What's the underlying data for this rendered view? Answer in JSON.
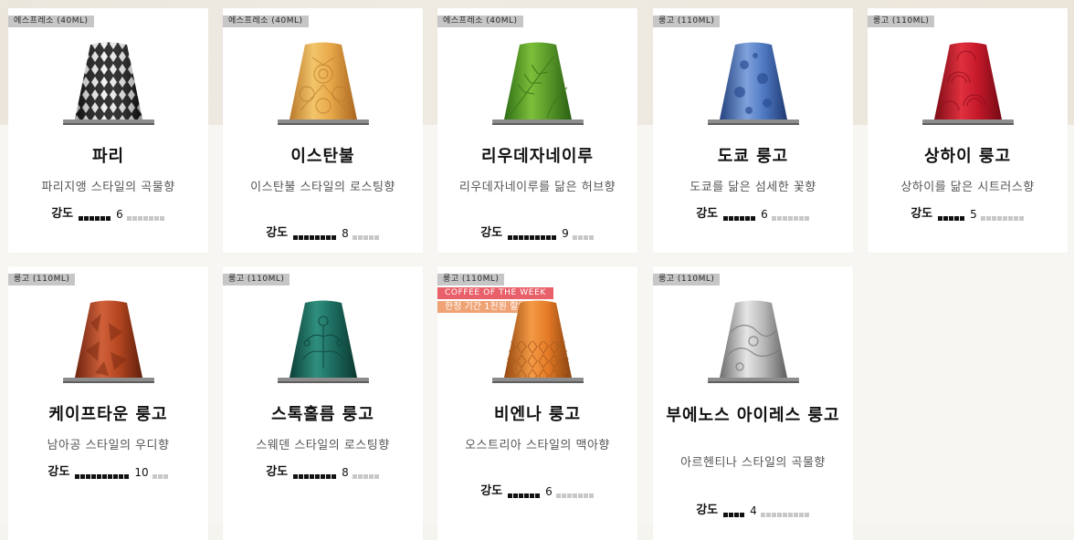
{
  "cards": [
    {
      "tag": "에스프레소 (40ML)",
      "name": "파리",
      "desc": "파리지앵 스타일의 곡물향",
      "intensity_label": "강도",
      "intensity": 6
    },
    {
      "tag": "에스프레소 (40ML)",
      "name": "이스탄불",
      "desc": "이스탄불 스타일의 로스팅향",
      "intensity_label": "강도",
      "intensity": 8
    },
    {
      "tag": "에스프레소 (40ML)",
      "name": "리우데자네이루",
      "desc": "리우데자네이루를 닮은 허브향",
      "intensity_label": "강도",
      "intensity": 9
    },
    {
      "tag": "룽고 (110ML)",
      "name": "도쿄 룽고",
      "desc": "도쿄를 닮은 섬세한 꽃향",
      "intensity_label": "강도",
      "intensity": 6
    },
    {
      "tag": "룽고 (110ML)",
      "name": "상하이 룽고",
      "desc": "상하이를 닮은 시트러스향",
      "intensity_label": "강도",
      "intensity": 5
    },
    {
      "tag": "룽고 (110ML)",
      "name": "케이프타운 룽고",
      "desc": "남아공 스타일의 우디향",
      "intensity_label": "강도",
      "intensity": 10
    },
    {
      "tag": "룽고 (110ML)",
      "name": "스톡홀름 룽고",
      "desc": "스웨덴 스타일의 로스팅향",
      "intensity_label": "강도",
      "intensity": 8
    },
    {
      "tag": "룽고 (110ML)",
      "name": "비엔나 룽고",
      "desc": "오스트리아 스타일의 맥아향",
      "intensity_label": "강도",
      "intensity": 6,
      "badge_1": "COFFEE OF THE WEEK",
      "badge_2": "한정 기간 1천원 할인"
    },
    {
      "tag": "룽고 (110ML)",
      "name": "부에노스 아이레스 룽고",
      "desc": "아르헨티나 스타일의 곡물향",
      "intensity_label": "강도",
      "intensity": 4
    }
  ],
  "intensity_max": 13,
  "colors": {
    "paris": "#1b1b1b",
    "istanbul": "#e3a545",
    "rio": "#5a9a2a",
    "tokyo": "#3f67b0",
    "shanghai": "#c4182a",
    "capetown": "#b4461f",
    "stockholm": "#1c6b5e",
    "vienna": "#e47a26",
    "buenosaires": "#b8b8b8",
    "badge_red": "#e8606a",
    "badge_orange": "#efa274"
  }
}
